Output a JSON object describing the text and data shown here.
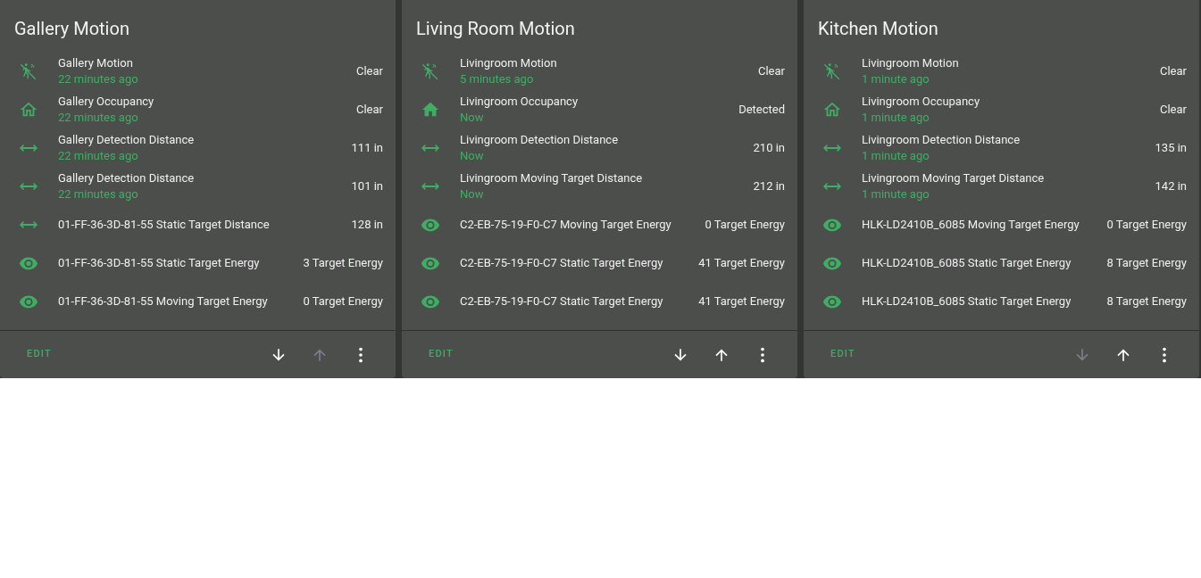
{
  "cards": [
    {
      "title": "Gallery Motion",
      "rows": [
        {
          "kind": "motion",
          "name": "Gallery Motion",
          "secondary": "22 minutes ago",
          "value": "Clear"
        },
        {
          "kind": "occupancy",
          "detected": false,
          "name": "Gallery Occupancy",
          "secondary": "22 minutes ago",
          "value": "Clear"
        },
        {
          "kind": "distance",
          "name": "Gallery Detection Distance",
          "secondary": "22 minutes ago",
          "value": "111 in"
        },
        {
          "kind": "distance",
          "name": "Gallery Detection Distance",
          "secondary": "22 minutes ago",
          "value": "101 in"
        },
        {
          "kind": "distance",
          "name": "01-FF-36-3D-81-55 Static Target Distance",
          "value": "128 in"
        },
        {
          "kind": "energy",
          "name": "01-FF-36-3D-81-55 Static Target Energy",
          "value": "3 Target Energy"
        },
        {
          "kind": "energy",
          "name": "01-FF-36-3D-81-55 Moving Target Energy",
          "value": "0 Target Energy"
        }
      ],
      "edit": "EDIT",
      "down_disabled": false,
      "up_disabled": true
    },
    {
      "title": "Living Room Motion",
      "rows": [
        {
          "kind": "motion",
          "name": "Livingroom Motion",
          "secondary": "5 minutes ago",
          "value": "Clear"
        },
        {
          "kind": "occupancy",
          "detected": true,
          "name": "Livingroom Occupancy",
          "secondary": "Now",
          "value": "Detected"
        },
        {
          "kind": "distance",
          "name": "Livingroom Detection Distance",
          "secondary": "Now",
          "value": "210 in"
        },
        {
          "kind": "distance",
          "name": "Livingroom Moving Target Distance",
          "secondary": "Now",
          "value": "212 in"
        },
        {
          "kind": "energy",
          "name": "C2-EB-75-19-F0-C7 Moving Target Energy",
          "value": "0 Target Energy"
        },
        {
          "kind": "energy",
          "name": "C2-EB-75-19-F0-C7 Static Target Energy",
          "value": "41 Target Energy"
        },
        {
          "kind": "energy",
          "name": "C2-EB-75-19-F0-C7 Static Target Energy",
          "value": "41 Target Energy"
        }
      ],
      "edit": "EDIT",
      "down_disabled": false,
      "up_disabled": false
    },
    {
      "title": "Kitchen Motion",
      "rows": [
        {
          "kind": "motion",
          "name": "Livingroom Motion",
          "secondary": "1 minute ago",
          "value": "Clear"
        },
        {
          "kind": "occupancy",
          "detected": false,
          "name": "Livingroom Occupancy",
          "secondary": "1 minute ago",
          "value": "Clear"
        },
        {
          "kind": "distance",
          "name": "Livingroom Detection Distance",
          "secondary": "1 minute ago",
          "value": "135 in"
        },
        {
          "kind": "distance",
          "name": "Livingroom Moving Target Distance",
          "secondary": "1 minute ago",
          "value": "142 in"
        },
        {
          "kind": "energy",
          "name": "HLK-LD2410B_6085 Moving Target Energy",
          "value": "0 Target Energy"
        },
        {
          "kind": "energy",
          "name": "HLK-LD2410B_6085 Static Target Energy",
          "value": "8 Target Energy"
        },
        {
          "kind": "energy",
          "name": "HLK-LD2410B_6085 Static Target Energy",
          "value": "8 Target Energy"
        }
      ],
      "edit": "EDIT",
      "down_disabled": true,
      "up_disabled": false
    }
  ]
}
